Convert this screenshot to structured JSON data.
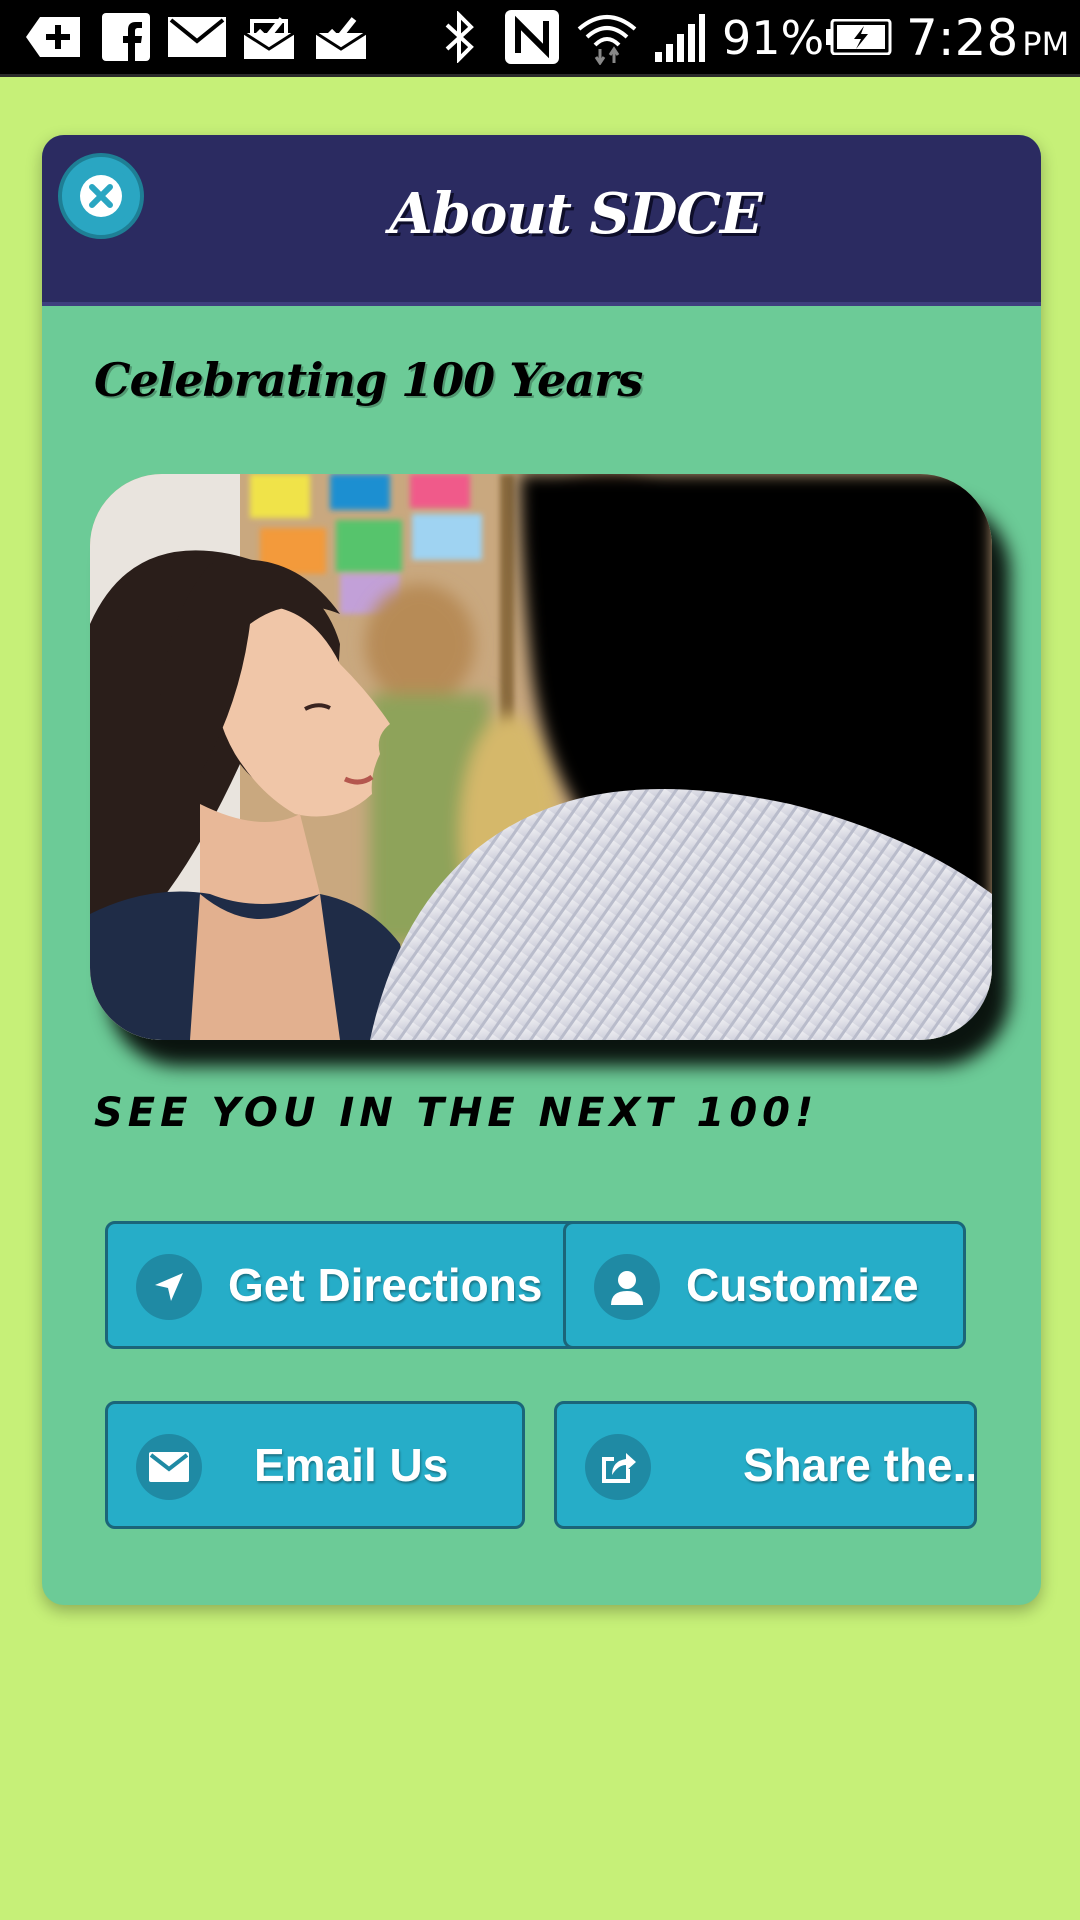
{
  "status_bar": {
    "icons": [
      "add-app-icon",
      "facebook-icon",
      "mail-icon",
      "inbox-check-icon",
      "inbox-check-icon",
      "bluetooth-icon",
      "nfc-icon",
      "wifi-icon",
      "signal-icon",
      "battery-charging-icon"
    ],
    "battery": "91%",
    "time": "7:28",
    "ampm": "PM"
  },
  "dialog": {
    "title": "About SDCE",
    "close_icon": "close-icon",
    "section_heading": "Celebrating 100 Years",
    "tagline": "See you in the next 100!"
  },
  "buttons": [
    {
      "label": "Get Directions",
      "icon": "navigation-arrow-icon"
    },
    {
      "label": "Customize",
      "icon": "person-icon"
    },
    {
      "label": "Email Us",
      "icon": "envelope-icon"
    },
    {
      "label": "Share the...",
      "icon": "share-icon"
    }
  ],
  "colors": {
    "page_background": "#c6f078",
    "header": "#2b2b61",
    "card": "#6ccb97",
    "button": "#26adc8",
    "button_border": "#1b6579"
  }
}
